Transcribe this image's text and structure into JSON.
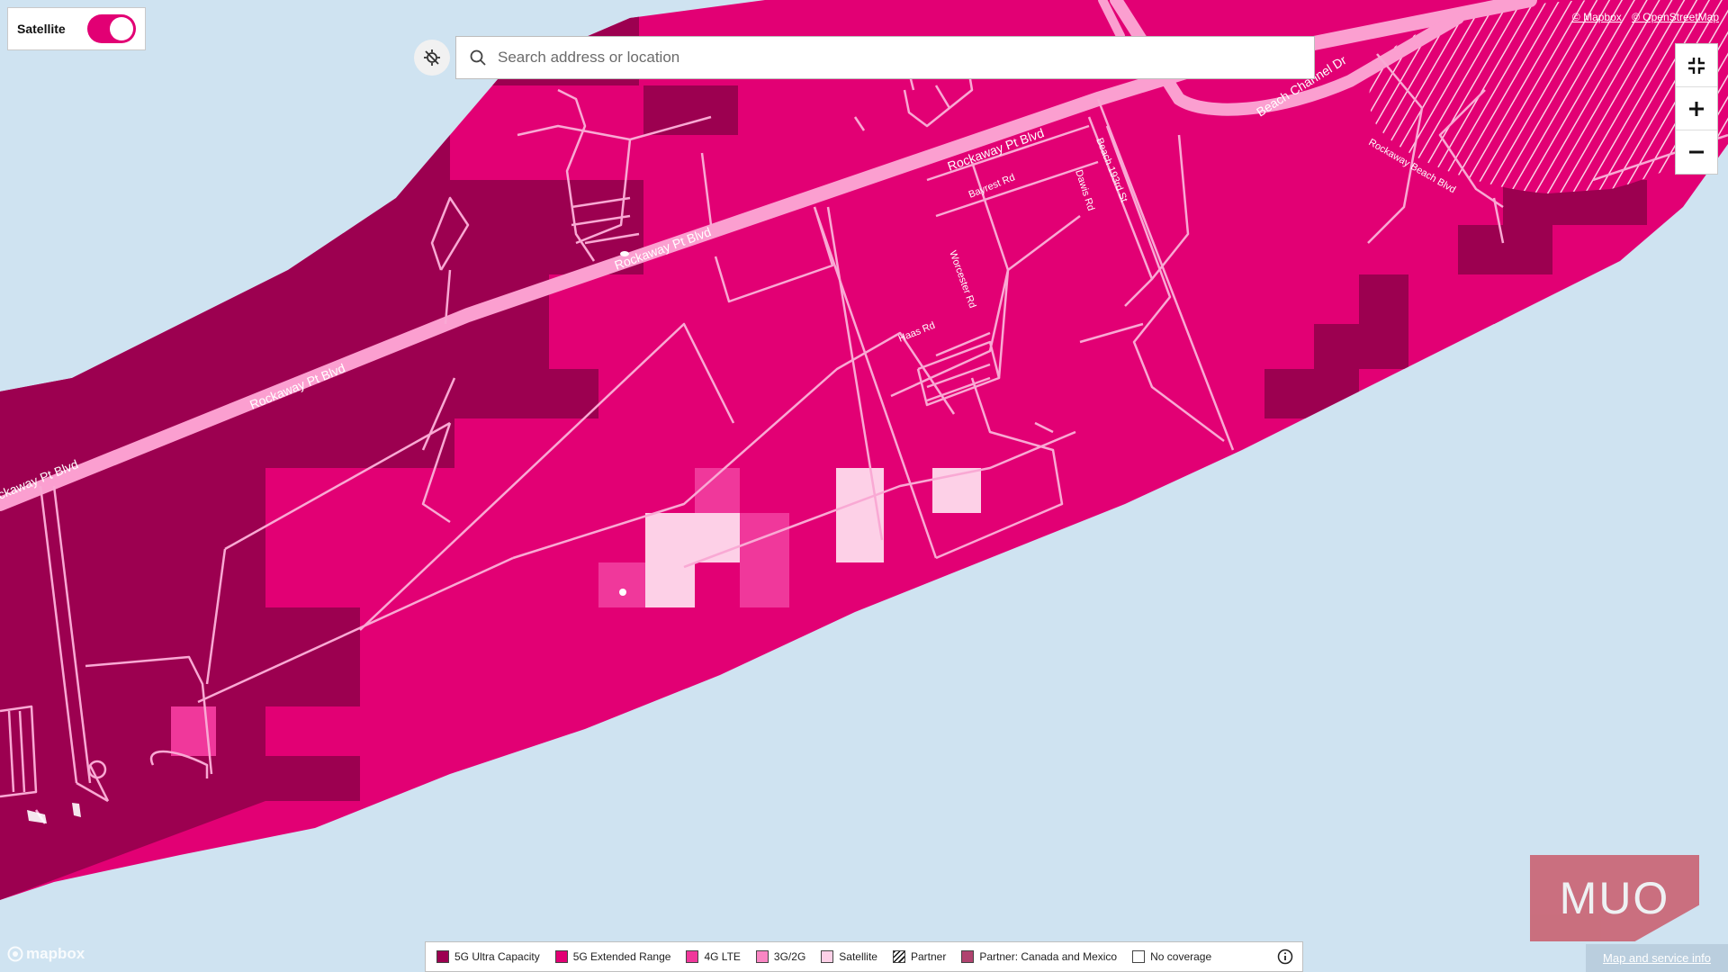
{
  "satellite_toggle": {
    "label": "Satellite",
    "state": "on"
  },
  "search": {
    "placeholder": "Search address or location"
  },
  "attribution": {
    "mapbox": "© Mapbox",
    "osm": "© OpenStreetMap"
  },
  "map_labels": {
    "rockaway_1": "Rockaway Pt Blvd",
    "rockaway_2": "Rockaway Pt Blvd",
    "rockaway_3": "Rockaway Pt Blvd",
    "rockaway_4": "ckaway Pt Blvd",
    "beach_channel": "Beach Channel Dr",
    "rockaway_beach": "Rockaway Beach Blvd",
    "beach_193": "Beach 193rd St",
    "bayrest": "Bayrest Rd",
    "dawis": "Dawis Rd",
    "worcester": "Worcester Rd",
    "haas": "Haas Rd"
  },
  "mapbox_logo": "mapbox",
  "legend": {
    "items": [
      {
        "label": "5G Ultra Capacity",
        "color": "#9c0050"
      },
      {
        "label": "5G Extended Range",
        "color": "#e20074"
      },
      {
        "label": "4G LTE",
        "color": "#f0389b"
      },
      {
        "label": "3G/2G",
        "color": "#f986c3"
      },
      {
        "label": "Satellite",
        "color": "#fdd0e7"
      },
      {
        "label": "Partner",
        "color": "hatch"
      },
      {
        "label": "Partner: Canada and Mexico",
        "color": "#b0436f"
      },
      {
        "label": "No coverage",
        "color": "#ffffff"
      }
    ]
  },
  "watermark": "MUO",
  "map_info": "Map and service info",
  "colors": {
    "water": "#cfe3f1",
    "brand_magenta": "#e20074",
    "ultra_capacity": "#9c0050"
  }
}
